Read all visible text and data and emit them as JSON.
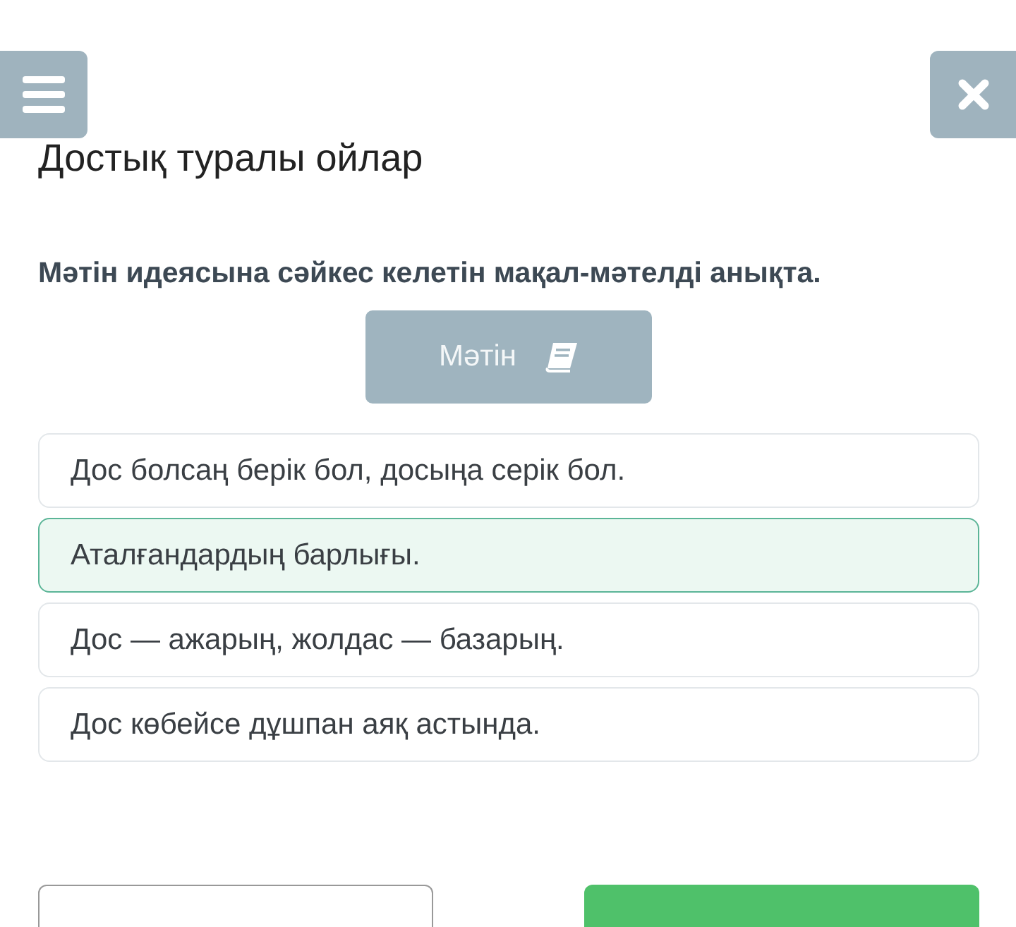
{
  "title": "Достық туралы ойлар",
  "question": "Мәтін идеясына сәйкес келетін мақал-мәтелді анықта.",
  "text_button": "Мәтін",
  "options": [
    {
      "label": "Дос болсаң берік бол, досыңа серік бол.",
      "selected": false
    },
    {
      "label": "Аталғандардың барлығы.",
      "selected": true
    },
    {
      "label": "Дос — ажарың, жолдас — базарың.",
      "selected": false
    },
    {
      "label": "Дос көбейсе дұшпан аяқ астында.",
      "selected": false
    }
  ]
}
